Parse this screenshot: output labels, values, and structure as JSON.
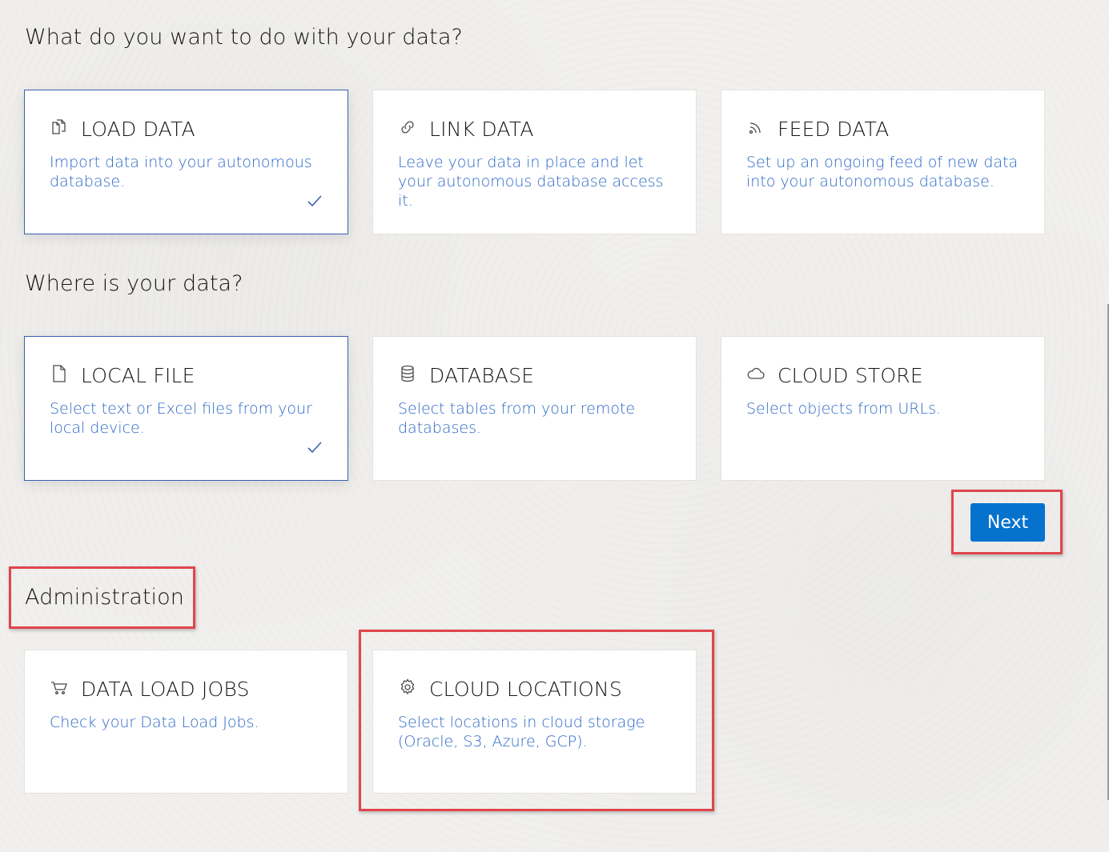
{
  "sections": {
    "what": {
      "heading": "What do you want to do with your data?",
      "cards": [
        {
          "title": "LOAD DATA",
          "description": "Import data into your autonomous database.",
          "icon": "load-data-icon",
          "selected": true
        },
        {
          "title": "LINK DATA",
          "description": "Leave your data in place and let your autonomous database access it.",
          "icon": "link-icon",
          "selected": false
        },
        {
          "title": "FEED DATA",
          "description": "Set up an ongoing feed of new data into your autonomous database.",
          "icon": "feed-icon",
          "selected": false
        }
      ]
    },
    "where": {
      "heading": "Where is your data?",
      "cards": [
        {
          "title": "LOCAL FILE",
          "description": "Select text or Excel files from your local device.",
          "icon": "file-icon",
          "selected": true
        },
        {
          "title": "DATABASE",
          "description": "Select tables from your remote databases.",
          "icon": "database-icon",
          "selected": false
        },
        {
          "title": "CLOUD STORE",
          "description": "Select objects from URLs.",
          "icon": "cloud-icon",
          "selected": false
        }
      ]
    },
    "admin": {
      "heading": "Administration",
      "cards": [
        {
          "title": "DATA LOAD JOBS",
          "description": "Check your Data Load Jobs.",
          "icon": "basket-icon"
        },
        {
          "title": "CLOUD LOCATIONS",
          "description": "Select locations in cloud storage (Oracle, S3, Azure, GCP).",
          "icon": "gear-icon"
        }
      ]
    }
  },
  "actions": {
    "next_label": "Next"
  },
  "colors": {
    "accent": "#0572ce",
    "link_text": "#2b67c6",
    "selected_border": "#3b5fb0",
    "annotation_red": "#e0454c"
  }
}
